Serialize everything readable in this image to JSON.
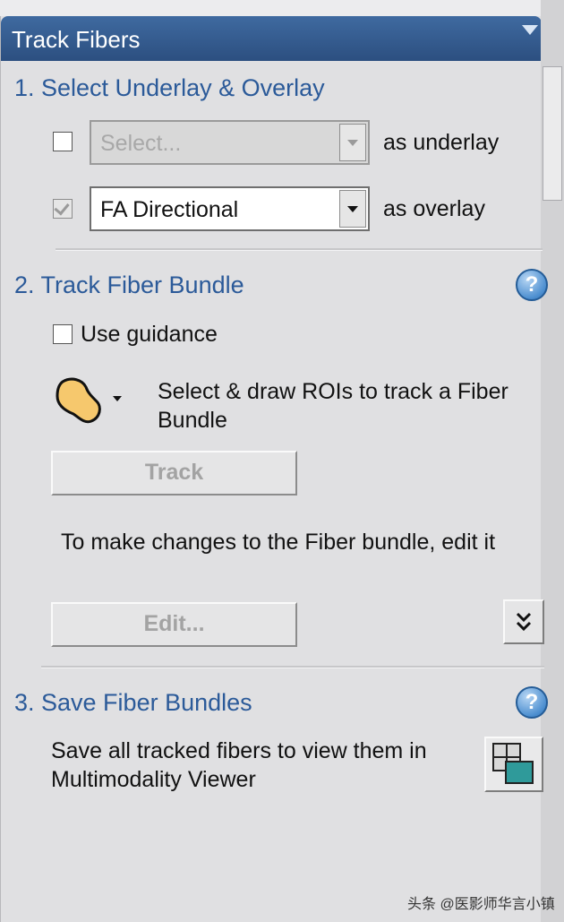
{
  "panel": {
    "title": "Track Fibers"
  },
  "section1": {
    "title": "1. Select Underlay & Overlay",
    "underlay": {
      "checked": false,
      "value": "Select...",
      "suffix": "as underlay"
    },
    "overlay": {
      "checked": true,
      "value": "FA Directional",
      "suffix": "as overlay"
    }
  },
  "section2": {
    "title": "2. Track Fiber Bundle",
    "help_label": "?",
    "guidance_label": "Use guidance",
    "roi_text": "Select & draw ROIs to track a Fiber Bundle",
    "track_label": "Track",
    "edit_text": "To make changes to the Fiber bundle, edit it",
    "edit_label": "Edit..."
  },
  "section3": {
    "title": "3. Save Fiber Bundles",
    "help_label": "?",
    "save_text": "Save all tracked fibers to view them in Multimodality Viewer"
  },
  "watermark": "头条 @医影师华言小镇",
  "colors": {
    "header": "#2c4f80",
    "section_title": "#2b5a99",
    "panel_bg": "#e0e0e2"
  },
  "icons": [
    "collapse-chevron-icon",
    "help-icon",
    "roi-freehand-icon",
    "expand-double-chevron-icon",
    "multimodality-viewer-icon"
  ]
}
